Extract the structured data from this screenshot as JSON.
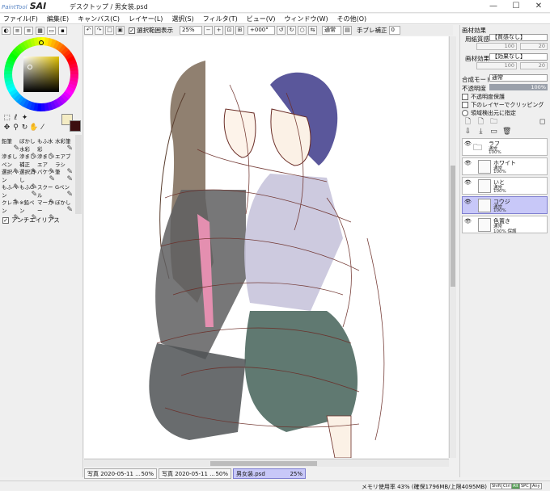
{
  "app": {
    "logo_small": "PaintTool",
    "logo_big": "SAI",
    "title": "デスクトップ / 男女装.psd",
    "win_minimize": "—",
    "win_maximize": "☐",
    "win_close": "✕"
  },
  "menubar": [
    "ファイル(F)",
    "編集(E)",
    "キャンバス(C)",
    "レイヤー(L)",
    "選択(S)",
    "フィルタ(T)",
    "ビュー(V)",
    "ウィンドウ(W)",
    "その他(O)"
  ],
  "toolbar": {
    "selection_label": "選択範囲表示",
    "zoom": "25%",
    "rotation": "+000°",
    "blend": "通常",
    "stabilizer_label": "手ブレ補正",
    "stabilizer_value": "0"
  },
  "left_panel": {
    "brushes": [
      {
        "label": "鉛筆",
        "icon": "✎"
      },
      {
        "label": "ぼかし水彩",
        "icon": "✎"
      },
      {
        "label": "もふ水彩",
        "icon": "✎"
      },
      {
        "label": "水彩筆",
        "icon": "✎"
      },
      {
        "label": "滲ましペン",
        "icon": "✎"
      },
      {
        "label": "滲まし補正",
        "icon": "✎"
      },
      {
        "label": "滲ましエア",
        "icon": "✎"
      },
      {
        "label": "エアブラシ",
        "icon": "✎"
      },
      {
        "label": "選択ペン",
        "icon": "✎"
      },
      {
        "label": "選択消し",
        "icon": "✎"
      },
      {
        "label": "バケツ",
        "icon": "✎"
      },
      {
        "label": "筆",
        "icon": "✎"
      },
      {
        "label": "もふペン",
        "icon": "✎"
      },
      {
        "label": "もふG",
        "icon": "✎"
      },
      {
        "label": "スクール",
        "icon": "✎"
      },
      {
        "label": "Gペン",
        "icon": "✎"
      },
      {
        "label": "クレヨン",
        "icon": "✎"
      },
      {
        "label": "※鉛ペン",
        "icon": "✎"
      },
      {
        "label": "マーカー",
        "icon": "✎"
      },
      {
        "label": "ぼかし",
        "icon": "✎"
      }
    ],
    "antialias_label": "アンチエイリアス",
    "primary_color": "#f4ecc4",
    "secondary_color": "#3c0e10"
  },
  "right_panel": {
    "material_effect_header": "画材効果",
    "paper_texture_label": "用紙質感",
    "paper_texture_value": "【質感なし】",
    "paper_num1": "100",
    "paper_num2": "20",
    "material_effect_label": "画材効果",
    "material_effect_value": "【効果なし】",
    "material_num1": "100",
    "material_num2": "20",
    "blend_mode_label": "合成モード",
    "blend_mode_value": "通常",
    "opacity_label": "不透明度",
    "opacity_value": "100%",
    "opacity_fraction": 1.0,
    "check_protect": "不透明度保護",
    "check_clip": "下のレイヤーでクリッピング",
    "check_source": "領域検出元に指定",
    "layers": [
      {
        "name": "ラフ",
        "mode": "通常",
        "opacity": "100%",
        "type": "folder",
        "selected": false
      },
      {
        "name": "ホワイト",
        "mode": "通常",
        "opacity": "100%",
        "type": "layer",
        "selected": false
      },
      {
        "name": "いと",
        "mode": "通常",
        "opacity": "100%",
        "type": "layer",
        "selected": false
      },
      {
        "name": "コウジ",
        "mode": "通常",
        "opacity": "100%",
        "type": "layer",
        "selected": true
      },
      {
        "name": "色置き",
        "mode": "通常",
        "opacity": "100% 保護",
        "type": "layer",
        "selected": false
      }
    ]
  },
  "doc_tabs": [
    {
      "name": "写真 2020-05-11 ...",
      "zoom": "50%",
      "active": false
    },
    {
      "name": "写真 2020-05-11 ...",
      "zoom": "50%",
      "active": false
    },
    {
      "name": "男女装.psd",
      "zoom": "25%",
      "active": true
    }
  ],
  "status": {
    "memory": "メモリ使用率 43% (確保1796MB/上限4095MB)",
    "keys": [
      "Shift",
      "Ctrl",
      "Alt",
      "SPC",
      "Any"
    ]
  }
}
